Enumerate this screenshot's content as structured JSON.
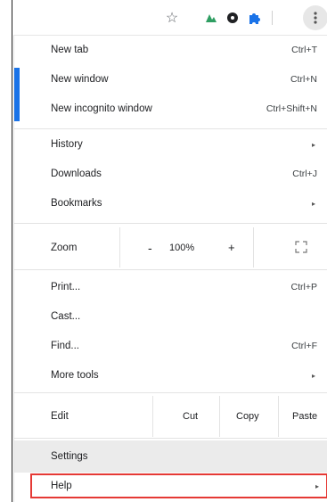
{
  "toolbar": {
    "icons": [
      "star-icon",
      "extension-a-icon",
      "extension-dot-icon",
      "puzzle-icon"
    ],
    "menu_button": "more-vert-icon"
  },
  "menu": {
    "new_tab": {
      "label": "New tab",
      "shortcut": "Ctrl+T"
    },
    "new_window": {
      "label": "New window",
      "shortcut": "Ctrl+N"
    },
    "new_incognito": {
      "label": "New incognito window",
      "shortcut": "Ctrl+Shift+N"
    },
    "history": {
      "label": "History"
    },
    "downloads": {
      "label": "Downloads",
      "shortcut": "Ctrl+J"
    },
    "bookmarks": {
      "label": "Bookmarks"
    },
    "zoom": {
      "label": "Zoom",
      "minus": "-",
      "value": "100%",
      "plus": "+"
    },
    "print": {
      "label": "Print...",
      "shortcut": "Ctrl+P"
    },
    "cast": {
      "label": "Cast..."
    },
    "find": {
      "label": "Find...",
      "shortcut": "Ctrl+F"
    },
    "more_tools": {
      "label": "More tools"
    },
    "edit": {
      "label": "Edit",
      "cut": "Cut",
      "copy": "Copy",
      "paste": "Paste"
    },
    "settings": {
      "label": "Settings"
    },
    "help": {
      "label": "Help"
    },
    "submenu_arrow": "▸"
  },
  "colors": {
    "accent": "#1a73e8",
    "highlight_border": "#e53935",
    "hover_bg": "#ebebeb"
  }
}
